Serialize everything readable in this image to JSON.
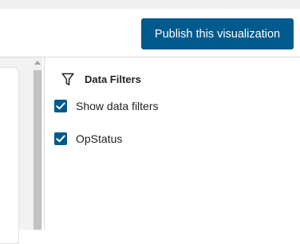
{
  "header": {
    "publish_label": "Publish this visualization"
  },
  "filters_panel": {
    "title": "Data Filters",
    "options": [
      {
        "label": "Show data filters",
        "checked": true
      },
      {
        "label": "OpStatus",
        "checked": true
      }
    ]
  },
  "colors": {
    "accent": "#005a8e",
    "panel_background": "#ffffff",
    "canvas_background": "#f2f2f2"
  },
  "icons": {
    "filter": "filter-icon",
    "check": "checkmark-icon"
  }
}
